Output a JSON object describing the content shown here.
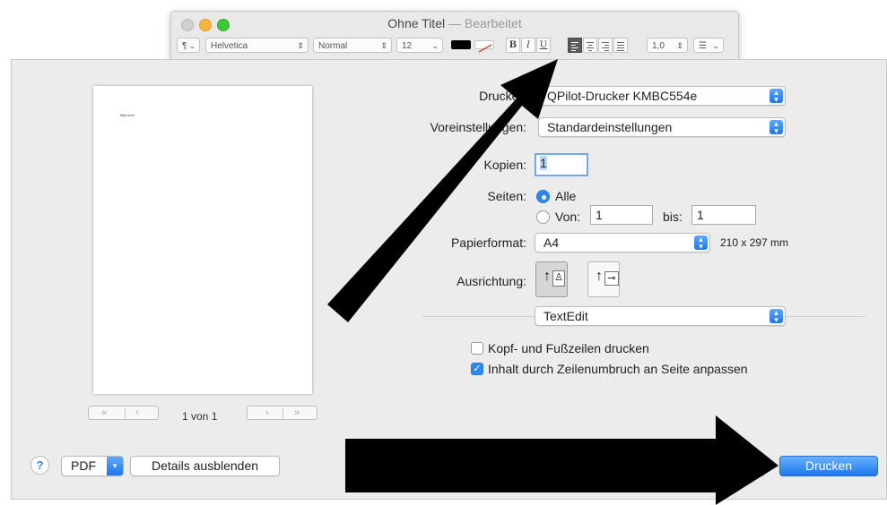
{
  "window": {
    "title": "Ohne Titel",
    "separator": "—",
    "status": "Bearbeitet"
  },
  "toolbar": {
    "paragraph_style": "¶",
    "font_family": "Helvetica",
    "font_style": "Normal",
    "font_size": "12",
    "bold": "B",
    "italic": "I",
    "underline": "U",
    "line_spacing": "1,0",
    "text_color": "#000000",
    "active_alignment": "left"
  },
  "preview": {
    "page_text": "Aller text",
    "page_indicator": "1 von 1",
    "first_prev": "«   ‹",
    "next_last": "›   »"
  },
  "print": {
    "printer_label": "Drucker:",
    "printer_value": "QPilot-Drucker KMBC554e",
    "presets_label": "Voreinstellungen:",
    "presets_value": "Standardeinstellungen",
    "copies_label": "Kopien:",
    "copies_value": "1",
    "pages_label": "Seiten:",
    "pages_all": "Alle",
    "pages_from": "Von:",
    "pages_from_value": "1",
    "pages_to": "bis:",
    "pages_to_value": "1",
    "paper_label": "Papierformat:",
    "paper_value": "A4",
    "paper_size": "210 x 297 mm",
    "orientation_label": "Ausrichtung:",
    "app_section": "TextEdit",
    "header_footer": "Kopf- und Fußzeilen drucken",
    "header_footer_checked": false,
    "wrap": "Inhalt durch Zeilenumbruch an Seite anpassen",
    "wrap_checked": true
  },
  "bottom": {
    "help": "?",
    "pdf": "PDF",
    "details": "Details ausblenden",
    "print": "Drucken"
  },
  "colors": {
    "accent": "#2f86f0",
    "annotation": "#000000"
  }
}
